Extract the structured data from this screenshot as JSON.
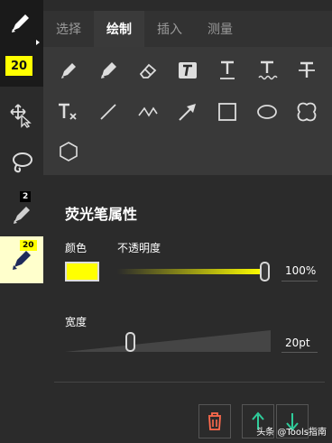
{
  "rail": {
    "pen_size": "20",
    "tools": [
      {
        "name": "highlighter-pen",
        "icon": "highlighter-icon"
      },
      {
        "name": "lasso-select",
        "icon": "move-select-icon"
      },
      {
        "name": "lasso",
        "icon": "lasso-icon"
      },
      {
        "name": "pencil",
        "icon": "pencil-icon",
        "badge": "2"
      },
      {
        "name": "marker",
        "icon": "marker-icon",
        "badge": "20"
      }
    ],
    "badge_pencil": "2",
    "badge_marker": "20"
  },
  "tabs": [
    {
      "label": "选择"
    },
    {
      "label": "绘制"
    },
    {
      "label": "插入"
    },
    {
      "label": "测量"
    }
  ],
  "active_tab": "绘制",
  "properties": {
    "title": "荧光笔属性",
    "color_label": "颜色",
    "color_value": "#ffff00",
    "opacity_label": "不透明度",
    "opacity_value": "100%",
    "opacity_fraction": 1.0,
    "width_label": "宽度",
    "width_value": "20pt"
  },
  "watermark": "头条 @Tools指南"
}
